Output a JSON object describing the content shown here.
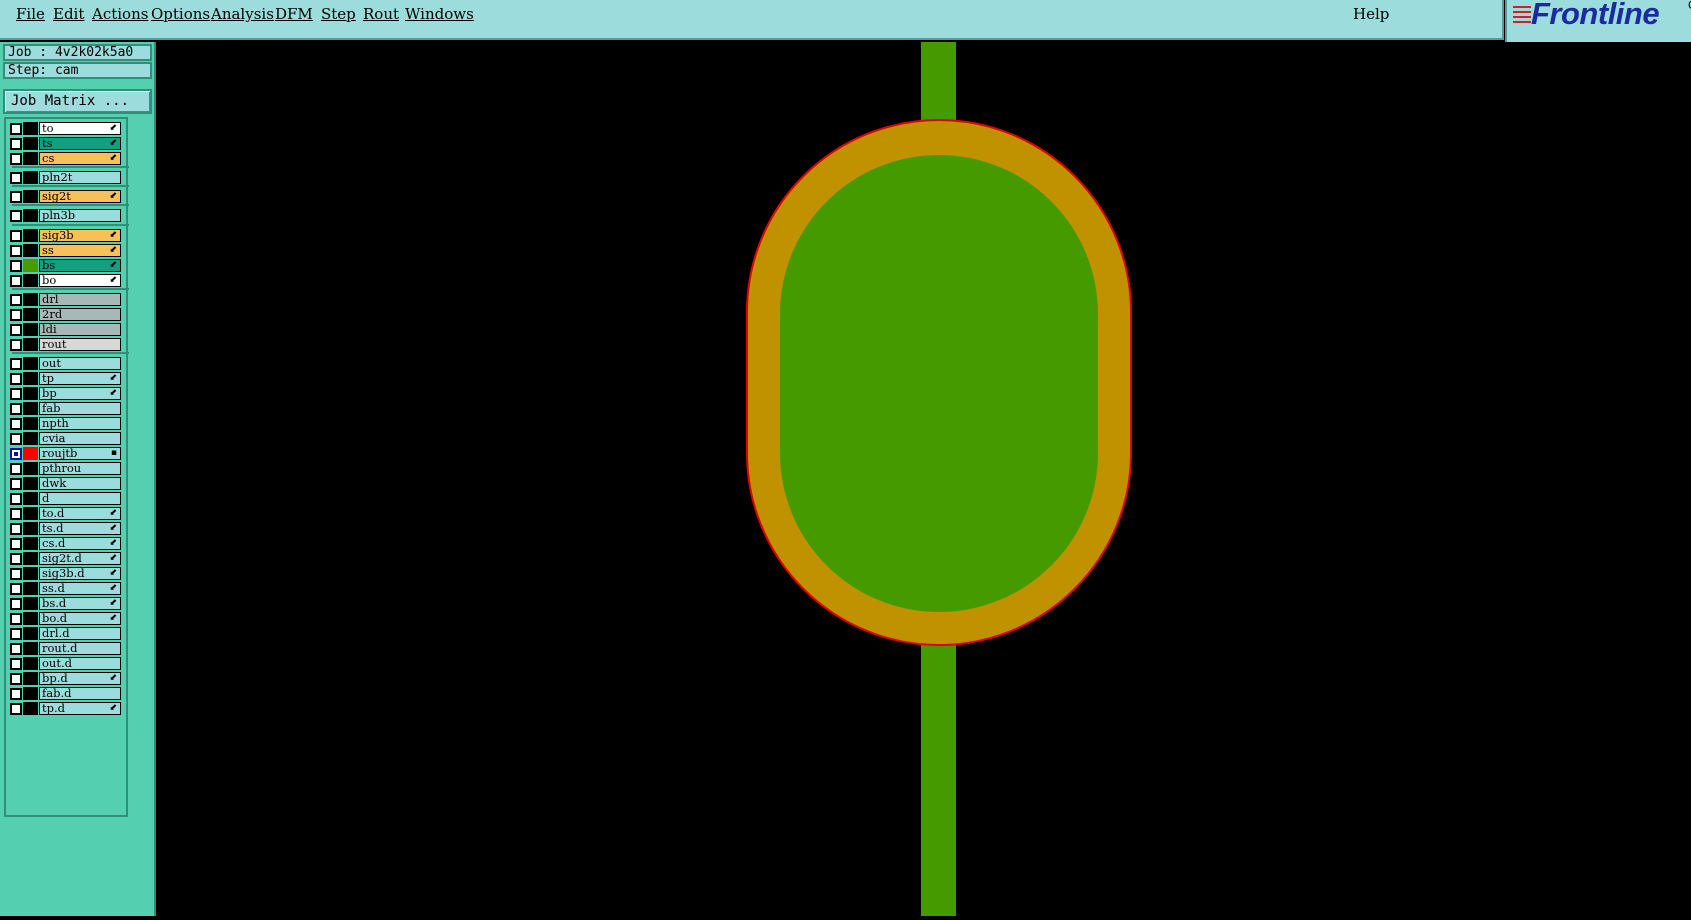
{
  "menu": {
    "items": [
      "File",
      "Edit",
      "Actions",
      "Options",
      "Analysis",
      "DFM",
      "Step",
      "Rout",
      "Windows"
    ],
    "help": "Help"
  },
  "logo": {
    "text": "Frontline",
    "corner": "G"
  },
  "info": {
    "job": "Job : 4v2k02k5a0",
    "step": "Step: cam"
  },
  "job_matrix_label": "Job Matrix ...",
  "layers": [
    {
      "name": "to",
      "color": "#ffffff",
      "mark": "⬋"
    },
    {
      "name": "ts",
      "color": "#12a080",
      "mark": "⬋"
    },
    {
      "name": "cs",
      "color": "#f8c058",
      "mark": "⬋"
    },
    {
      "name": "pln2t",
      "color": "#9cdcdc",
      "mark": ""
    },
    {
      "name": "sig2t",
      "color": "#f8c058",
      "mark": "⬋"
    },
    {
      "name": "pln3b",
      "color": "#9cdcdc",
      "mark": ""
    },
    {
      "name": "sig3b",
      "color": "#f8c058",
      "mark": "⬋"
    },
    {
      "name": "ss",
      "color": "#f8c058",
      "mark": "⬋"
    },
    {
      "name": "bs",
      "color": "#12a080",
      "mark": "⬋",
      "swatch": "#4a9a00"
    },
    {
      "name": "bo",
      "color": "#ffffff",
      "mark": "⬋"
    },
    {
      "name": "drl",
      "color": "#a8b8b8",
      "mark": ""
    },
    {
      "name": "2rd",
      "color": "#a8b8b8",
      "mark": ""
    },
    {
      "name": "ldi",
      "color": "#a8b8b8",
      "mark": ""
    },
    {
      "name": "rout",
      "color": "#d8d8d8",
      "mark": ""
    },
    {
      "name": "out",
      "color": "#9cdcdc",
      "mark": ""
    },
    {
      "name": "tp",
      "color": "#9cdcdc",
      "mark": "⬋"
    },
    {
      "name": "bp",
      "color": "#9cdcdc",
      "mark": "⬋"
    },
    {
      "name": "fab",
      "color": "#9cdcdc",
      "mark": ""
    },
    {
      "name": "npth",
      "color": "#9cdcdc",
      "mark": ""
    },
    {
      "name": "cvia",
      "color": "#9cdcdc",
      "mark": ""
    },
    {
      "name": "roujtb",
      "color": "#9cdcdc",
      "mark": "▪",
      "swatch": "#ff0000",
      "active": true
    },
    {
      "name": "pthrou",
      "color": "#9cdcdc",
      "mark": ""
    },
    {
      "name": "dwk",
      "color": "#9cdcdc",
      "mark": ""
    },
    {
      "name": "d",
      "color": "#9cdcdc",
      "mark": ""
    },
    {
      "name": "to.d",
      "color": "#9cdcdc",
      "mark": "⬋"
    },
    {
      "name": "ts.d",
      "color": "#9cdcdc",
      "mark": "⬋"
    },
    {
      "name": "cs.d",
      "color": "#9cdcdc",
      "mark": "⬋"
    },
    {
      "name": "sig2t.d",
      "color": "#9cdcdc",
      "mark": "⬋"
    },
    {
      "name": "sig3b.d",
      "color": "#9cdcdc",
      "mark": "⬋"
    },
    {
      "name": "ss.d",
      "color": "#9cdcdc",
      "mark": "⬋"
    },
    {
      "name": "bs.d",
      "color": "#9cdcdc",
      "mark": "⬋"
    },
    {
      "name": "bo.d",
      "color": "#9cdcdc",
      "mark": "⬋"
    },
    {
      "name": "drl.d",
      "color": "#9cdcdc",
      "mark": ""
    },
    {
      "name": "rout.d",
      "color": "#9cdcdc",
      "mark": ""
    },
    {
      "name": "out.d",
      "color": "#9cdcdc",
      "mark": ""
    },
    {
      "name": "bp.d",
      "color": "#9cdcdc",
      "mark": "⬋"
    },
    {
      "name": "fab.d",
      "color": "#9cdcdc",
      "mark": ""
    },
    {
      "name": "tp.d",
      "color": "#9cdcdc",
      "mark": "⬋"
    }
  ],
  "colors": {
    "trace": "#459a00",
    "pad_ring": "#c09200",
    "pad_outline": "#e00000",
    "canvas_bg": "#000000"
  }
}
